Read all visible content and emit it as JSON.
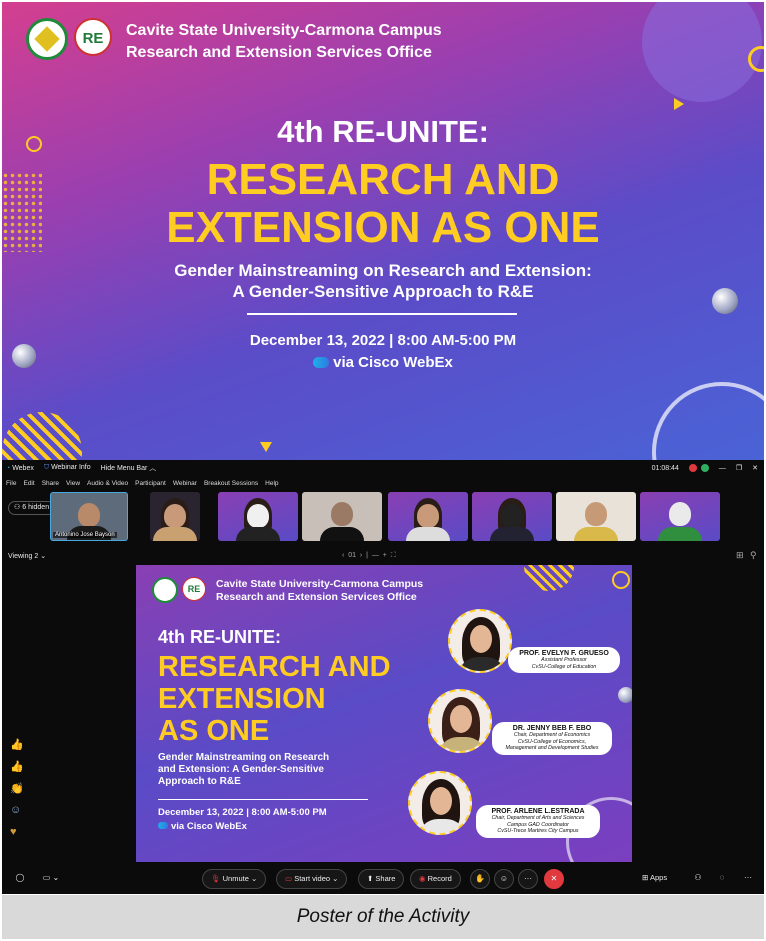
{
  "poster": {
    "header_line1": "Cavite State University-Carmona Campus",
    "header_line2": "Research and Extension Services Office",
    "logo_text": "RE",
    "title1": "4th RE-UNITE:",
    "title2_line1": "RESEARCH AND",
    "title2_line2": "EXTENSION AS ONE",
    "subtitle_line1": "Gender Mainstreaming on Research and Extension:",
    "subtitle_line2": "A Gender-Sensitive Approach to R&E",
    "date": "December 13, 2022 | 8:00 AM-5:00 PM",
    "via": "via Cisco WebEx"
  },
  "webex": {
    "titlebar": {
      "app": "Webex",
      "info": "Webinar Info",
      "hide_menu": "Hide Menu Bar",
      "time": "01:08:44"
    },
    "menu": [
      "File",
      "Edit",
      "Share",
      "View",
      "Audio & Video",
      "Participant",
      "Webinar",
      "Breakout Sessions",
      "Help"
    ],
    "hidden_count": "6 hidden",
    "self_name": "Antonino Jose Bayson",
    "viewing": "Viewing 2",
    "page": "01",
    "slide": {
      "header_line1": "Cavite State University-Carmona Campus",
      "header_line2": "Research and Extension Services Office",
      "title1": "4th RE-UNITE:",
      "title2_line1": "RESEARCH AND",
      "title2_line2": "EXTENSION",
      "title2_line3": "AS ONE",
      "subtitle_line1": "Gender Mainstreaming on Research",
      "subtitle_line2": "and Extension: A Gender-Sensitive",
      "subtitle_line3": "Approach to R&E",
      "date": "December 13, 2022 | 8:00 AM-5:00 PM",
      "via": "via Cisco WebEx",
      "speakers": [
        {
          "name": "PROF. EVELYN F. GRUESO",
          "role1": "Assistant Professor",
          "role2": "CvSU-College of Education",
          "role3": ""
        },
        {
          "name": "DR. JENNY BEB F. EBO",
          "role1": "Chair, Department of Economics",
          "role2": "CvSU-College of Economics,",
          "role3": "Management and Development Studies"
        },
        {
          "name": "PROF. ARLENE L.ESTRADA",
          "role1": "Chair, Department of Arts and Sciences",
          "role2": "Campus GAD Coordinator",
          "role3": "CvSU-Trece Martires City Campus"
        }
      ]
    },
    "controls": {
      "unmute": "Unmute",
      "start_video": "Start video",
      "share": "Share",
      "record": "Record",
      "apps": "Apps"
    }
  },
  "caption": "Poster of the Activity"
}
